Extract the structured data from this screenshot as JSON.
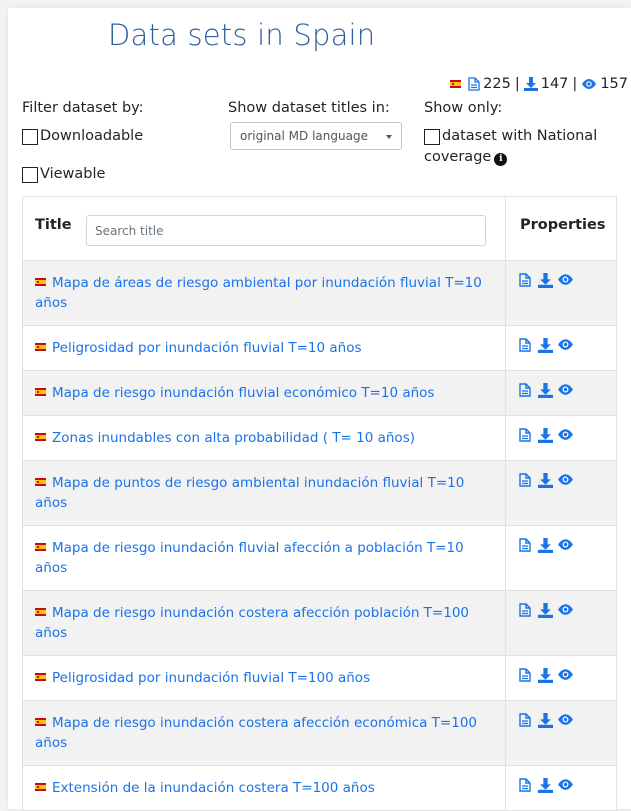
{
  "page": {
    "title": "Data sets in Spain",
    "stats": {
      "metadata_count": "225",
      "download_count": "147",
      "view_count": "157",
      "sep": "|"
    }
  },
  "filters": {
    "filter_label": "Filter dataset by:",
    "downloadable_label": "Downloadable",
    "viewable_label": "Viewable",
    "show_titles_label": "Show dataset titles in:",
    "language_select_value": "original MD language",
    "show_only_label": "Show only:",
    "national_line1": "dataset with National",
    "national_line2": "coverage"
  },
  "table": {
    "title_header": "Title",
    "search_placeholder": "Search title",
    "properties_header": "Properties",
    "rows": [
      "Mapa de áreas de riesgo ambiental por inundación fluvial T=10 años",
      "Peligrosidad por inundación fluvial T=10 años",
      "Mapa de riesgo inundación fluvial económico T=10 años",
      "Zonas inundables con alta probabilidad ( T= 10 años)",
      "Mapa de puntos de riesgo ambiental inundación fluvial T=10 años",
      "Mapa de riesgo inundación fluvial afección a población T=10 años",
      "Mapa de riesgo inundación costera afección población T=100 años",
      "Peligrosidad por inundación fluvial T=100 años",
      "Mapa de riesgo inundación costera afección económica T=100 años",
      "Extensión de la inundación costera T=100 años"
    ]
  },
  "colors": {
    "accent": "#1a73e8",
    "title_blue": "#2b5f9e",
    "row_stripe": "#f2f2f2"
  },
  "icons": [
    "spain-flag-icon",
    "metadata-file-icon",
    "download-icon",
    "eye-icon",
    "info-icon",
    "caret-down-icon"
  ]
}
